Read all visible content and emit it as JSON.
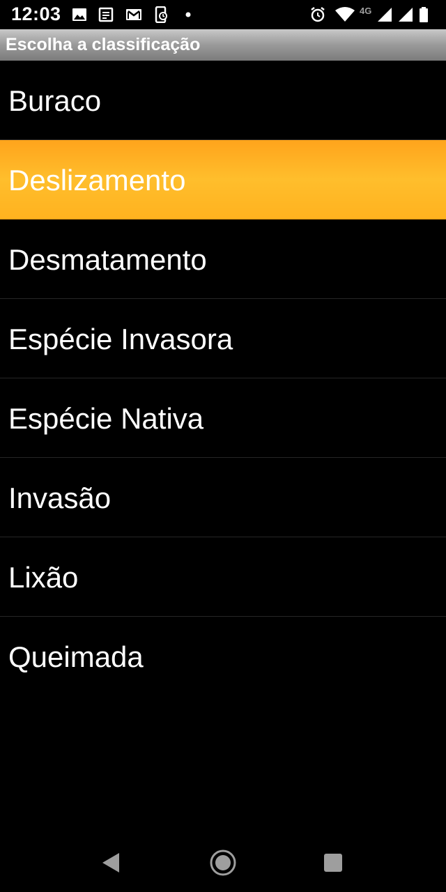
{
  "status_bar": {
    "time": "12:03",
    "network": "4G",
    "icons": [
      "image-icon",
      "news-icon",
      "gmail-icon",
      "phone-sync-icon",
      "dot-icon",
      "alarm-icon",
      "wifi-icon",
      "cell-signal-icon",
      "cell-signal-icon",
      "battery-icon"
    ]
  },
  "dialog": {
    "title": "Escolha a classificação",
    "items": [
      {
        "label": "Buraco"
      },
      {
        "label": "Deslizamento",
        "selected": true
      },
      {
        "label": "Desmatamento"
      },
      {
        "label": "Espécie Invasora"
      },
      {
        "label": "Espécie Nativa"
      },
      {
        "label": "Invasão"
      },
      {
        "label": "Lixão"
      },
      {
        "label": "Queimada"
      }
    ]
  },
  "nav_bar": {
    "buttons": [
      "back-icon",
      "home-icon",
      "recents-icon"
    ]
  },
  "colors": {
    "highlight": "#ffb21f",
    "background": "#000000",
    "title_bar": "#9a9a9a",
    "text": "#ffffff"
  }
}
